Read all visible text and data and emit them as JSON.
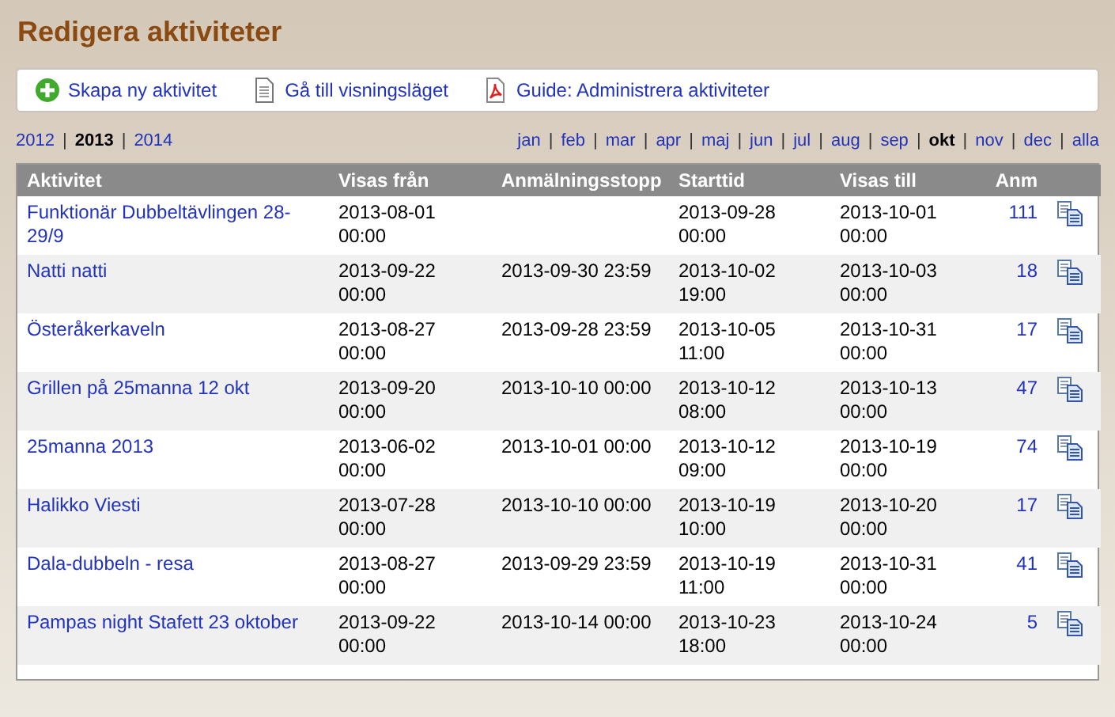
{
  "title": "Redigera aktiviteter",
  "toolbar": [
    {
      "kind": "add",
      "label": "Skapa ny aktivitet"
    },
    {
      "kind": "page",
      "label": "Gå till visningsläget"
    },
    {
      "kind": "pdf",
      "label": "Guide: Administrera aktiviteter"
    }
  ],
  "separator": "|",
  "years": [
    {
      "label": "2012",
      "selected": false
    },
    {
      "label": "2013",
      "selected": true
    },
    {
      "label": "2014",
      "selected": false
    }
  ],
  "months": [
    {
      "label": "jan",
      "selected": false
    },
    {
      "label": "feb",
      "selected": false
    },
    {
      "label": "mar",
      "selected": false
    },
    {
      "label": "apr",
      "selected": false
    },
    {
      "label": "maj",
      "selected": false
    },
    {
      "label": "jun",
      "selected": false
    },
    {
      "label": "jul",
      "selected": false
    },
    {
      "label": "aug",
      "selected": false
    },
    {
      "label": "sep",
      "selected": false
    },
    {
      "label": "okt",
      "selected": true
    },
    {
      "label": "nov",
      "selected": false
    },
    {
      "label": "dec",
      "selected": false
    },
    {
      "label": "alla",
      "selected": false
    }
  ],
  "table": {
    "columns": [
      "Aktivitet",
      "Visas från",
      "Anmälningsstopp",
      "Starttid",
      "Visas till",
      "Anm"
    ],
    "rows": [
      {
        "name": "Funktionär Dubbeltävlingen 28-29/9",
        "shown_from": "2013-08-01 00:00",
        "signup_stop": "",
        "start": "2013-09-28 00:00",
        "shown_to": "2013-10-01 00:00",
        "count": "111"
      },
      {
        "name": "Natti natti",
        "shown_from": "2013-09-22 00:00",
        "signup_stop": "2013-09-30 23:59",
        "start": "2013-10-02 19:00",
        "shown_to": "2013-10-03 00:00",
        "count": "18"
      },
      {
        "name": "Österåkerkaveln",
        "shown_from": "2013-08-27 00:00",
        "signup_stop": "2013-09-28 23:59",
        "start": "2013-10-05 11:00",
        "shown_to": "2013-10-31 00:00",
        "count": "17"
      },
      {
        "name": "Grillen på 25manna 12 okt",
        "shown_from": "2013-09-20 00:00",
        "signup_stop": "2013-10-10 00:00",
        "start": "2013-10-12 08:00",
        "shown_to": "2013-10-13 00:00",
        "count": "47"
      },
      {
        "name": "25manna 2013",
        "shown_from": "2013-06-02 00:00",
        "signup_stop": "2013-10-01 00:00",
        "start": "2013-10-12 09:00",
        "shown_to": "2013-10-19 00:00",
        "count": "74"
      },
      {
        "name": "Halikko Viesti",
        "shown_from": "2013-07-28 00:00",
        "signup_stop": "2013-10-10 00:00",
        "start": "2013-10-19 10:00",
        "shown_to": "2013-10-20 00:00",
        "count": "17"
      },
      {
        "name": "Dala-dubbeln - resa",
        "shown_from": "2013-08-27 00:00",
        "signup_stop": "2013-09-29 23:59",
        "start": "2013-10-19 11:00",
        "shown_to": "2013-10-31 00:00",
        "count": "41"
      },
      {
        "name": "Pampas night Stafett 23 oktober",
        "shown_from": "2013-09-22 00:00",
        "signup_stop": "2013-10-14 00:00",
        "start": "2013-10-23 18:00",
        "shown_to": "2013-10-24 00:00",
        "count": "5"
      }
    ]
  }
}
